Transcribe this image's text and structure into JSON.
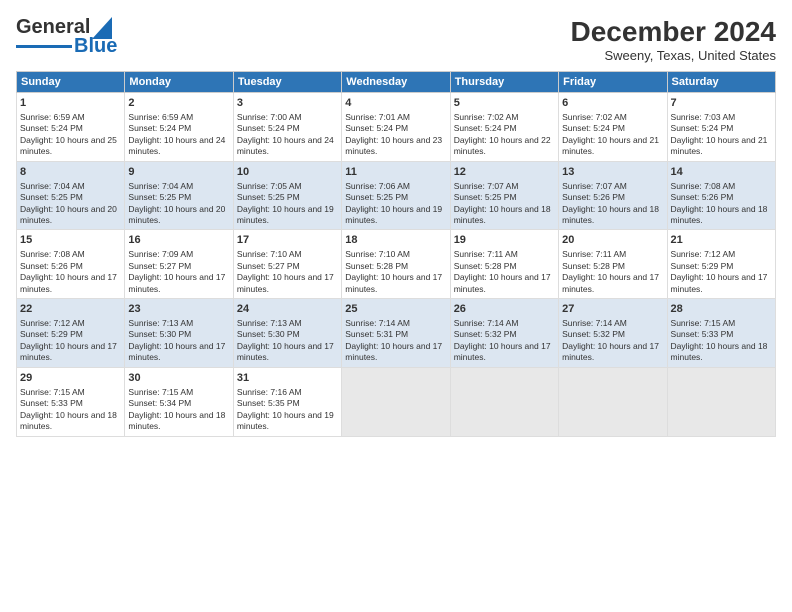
{
  "logo": {
    "part1": "General",
    "part2": "Blue"
  },
  "title": "December 2024",
  "subtitle": "Sweeny, Texas, United States",
  "days_of_week": [
    "Sunday",
    "Monday",
    "Tuesday",
    "Wednesday",
    "Thursday",
    "Friday",
    "Saturday"
  ],
  "weeks": [
    [
      {
        "day": "1",
        "sunrise": "6:59 AM",
        "sunset": "5:24 PM",
        "daylight": "10 hours and 25 minutes."
      },
      {
        "day": "2",
        "sunrise": "6:59 AM",
        "sunset": "5:24 PM",
        "daylight": "10 hours and 24 minutes."
      },
      {
        "day": "3",
        "sunrise": "7:00 AM",
        "sunset": "5:24 PM",
        "daylight": "10 hours and 24 minutes."
      },
      {
        "day": "4",
        "sunrise": "7:01 AM",
        "sunset": "5:24 PM",
        "daylight": "10 hours and 23 minutes."
      },
      {
        "day": "5",
        "sunrise": "7:02 AM",
        "sunset": "5:24 PM",
        "daylight": "10 hours and 22 minutes."
      },
      {
        "day": "6",
        "sunrise": "7:02 AM",
        "sunset": "5:24 PM",
        "daylight": "10 hours and 21 minutes."
      },
      {
        "day": "7",
        "sunrise": "7:03 AM",
        "sunset": "5:24 PM",
        "daylight": "10 hours and 21 minutes."
      }
    ],
    [
      {
        "day": "8",
        "sunrise": "7:04 AM",
        "sunset": "5:25 PM",
        "daylight": "10 hours and 20 minutes."
      },
      {
        "day": "9",
        "sunrise": "7:04 AM",
        "sunset": "5:25 PM",
        "daylight": "10 hours and 20 minutes."
      },
      {
        "day": "10",
        "sunrise": "7:05 AM",
        "sunset": "5:25 PM",
        "daylight": "10 hours and 19 minutes."
      },
      {
        "day": "11",
        "sunrise": "7:06 AM",
        "sunset": "5:25 PM",
        "daylight": "10 hours and 19 minutes."
      },
      {
        "day": "12",
        "sunrise": "7:07 AM",
        "sunset": "5:25 PM",
        "daylight": "10 hours and 18 minutes."
      },
      {
        "day": "13",
        "sunrise": "7:07 AM",
        "sunset": "5:26 PM",
        "daylight": "10 hours and 18 minutes."
      },
      {
        "day": "14",
        "sunrise": "7:08 AM",
        "sunset": "5:26 PM",
        "daylight": "10 hours and 18 minutes."
      }
    ],
    [
      {
        "day": "15",
        "sunrise": "7:08 AM",
        "sunset": "5:26 PM",
        "daylight": "10 hours and 17 minutes."
      },
      {
        "day": "16",
        "sunrise": "7:09 AM",
        "sunset": "5:27 PM",
        "daylight": "10 hours and 17 minutes."
      },
      {
        "day": "17",
        "sunrise": "7:10 AM",
        "sunset": "5:27 PM",
        "daylight": "10 hours and 17 minutes."
      },
      {
        "day": "18",
        "sunrise": "7:10 AM",
        "sunset": "5:28 PM",
        "daylight": "10 hours and 17 minutes."
      },
      {
        "day": "19",
        "sunrise": "7:11 AM",
        "sunset": "5:28 PM",
        "daylight": "10 hours and 17 minutes."
      },
      {
        "day": "20",
        "sunrise": "7:11 AM",
        "sunset": "5:28 PM",
        "daylight": "10 hours and 17 minutes."
      },
      {
        "day": "21",
        "sunrise": "7:12 AM",
        "sunset": "5:29 PM",
        "daylight": "10 hours and 17 minutes."
      }
    ],
    [
      {
        "day": "22",
        "sunrise": "7:12 AM",
        "sunset": "5:29 PM",
        "daylight": "10 hours and 17 minutes."
      },
      {
        "day": "23",
        "sunrise": "7:13 AM",
        "sunset": "5:30 PM",
        "daylight": "10 hours and 17 minutes."
      },
      {
        "day": "24",
        "sunrise": "7:13 AM",
        "sunset": "5:30 PM",
        "daylight": "10 hours and 17 minutes."
      },
      {
        "day": "25",
        "sunrise": "7:14 AM",
        "sunset": "5:31 PM",
        "daylight": "10 hours and 17 minutes."
      },
      {
        "day": "26",
        "sunrise": "7:14 AM",
        "sunset": "5:32 PM",
        "daylight": "10 hours and 17 minutes."
      },
      {
        "day": "27",
        "sunrise": "7:14 AM",
        "sunset": "5:32 PM",
        "daylight": "10 hours and 17 minutes."
      },
      {
        "day": "28",
        "sunrise": "7:15 AM",
        "sunset": "5:33 PM",
        "daylight": "10 hours and 18 minutes."
      }
    ],
    [
      {
        "day": "29",
        "sunrise": "7:15 AM",
        "sunset": "5:33 PM",
        "daylight": "10 hours and 18 minutes."
      },
      {
        "day": "30",
        "sunrise": "7:15 AM",
        "sunset": "5:34 PM",
        "daylight": "10 hours and 18 minutes."
      },
      {
        "day": "31",
        "sunrise": "7:16 AM",
        "sunset": "5:35 PM",
        "daylight": "10 hours and 19 minutes."
      },
      null,
      null,
      null,
      null
    ]
  ]
}
